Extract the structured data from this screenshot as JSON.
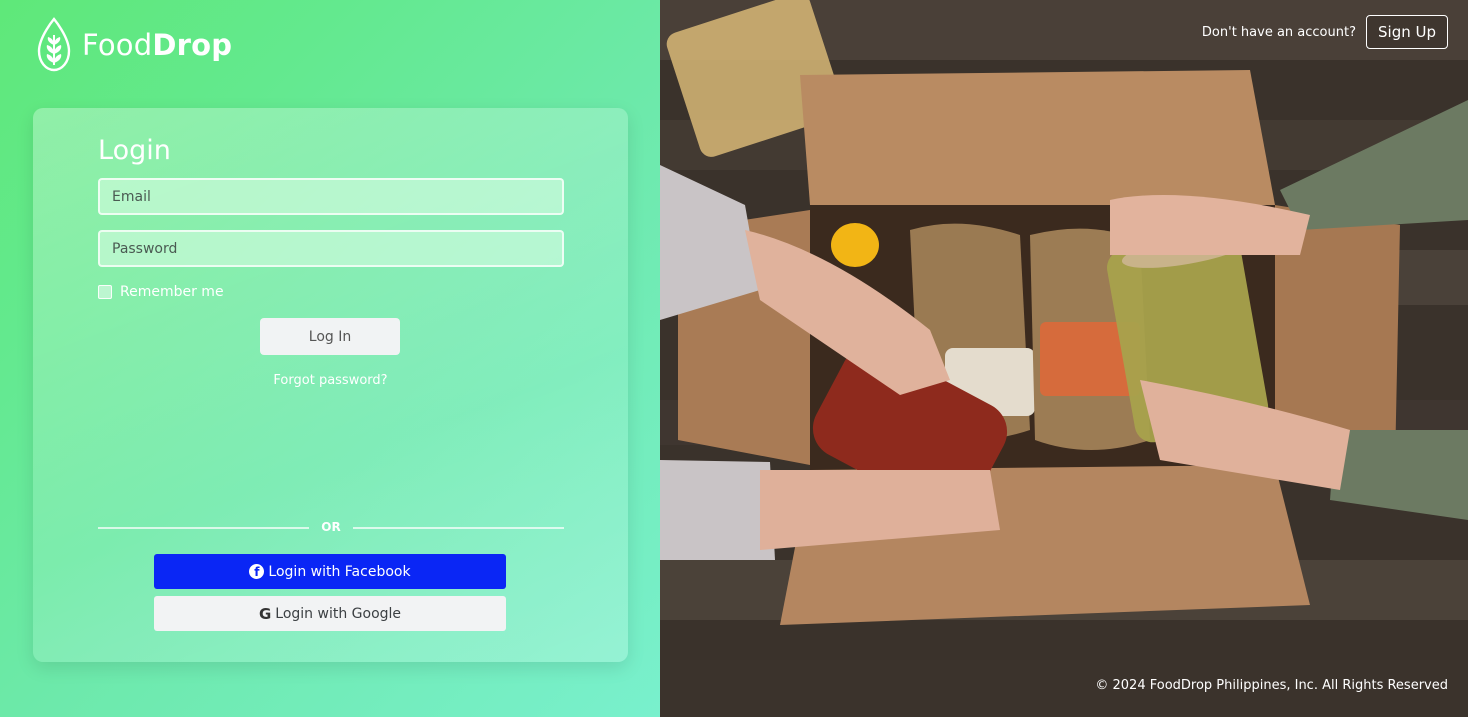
{
  "brand": {
    "name_light": "Food",
    "name_bold": "Drop"
  },
  "login_form": {
    "title": "Login",
    "email_placeholder": "Email",
    "password_placeholder": "Password",
    "remember_label": "Remember me",
    "login_button": "Log In",
    "forgot_link": "Forgot password?",
    "divider_text": "OR",
    "facebook_button": "Login with Facebook",
    "google_button": "Login with Google"
  },
  "header": {
    "signup_prompt": "Don't have an account?",
    "signup_button": "Sign Up"
  },
  "footer": {
    "copyright": "© 2024 FoodDrop Philippines, Inc. All Rights Reserved"
  },
  "colors": {
    "brand_green": "#63e98e",
    "facebook_blue": "#0a26f5"
  },
  "icons": [
    "leaf-drop-logo-icon",
    "facebook-icon",
    "google-icon"
  ]
}
